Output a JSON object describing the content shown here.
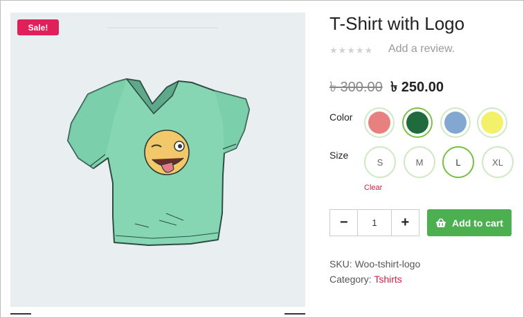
{
  "product": {
    "sale_badge": "Sale!",
    "title": "T-Shirt with Logo",
    "rating_stars": 5,
    "rating_value": 0,
    "review_link": "Add a review.",
    "price_old": "৳ 300.00",
    "price_new": "৳ 250.00"
  },
  "attributes": {
    "color_label": "Color",
    "size_label": "Size",
    "colors": [
      {
        "name": "red",
        "hex": "#e88080",
        "selected": false
      },
      {
        "name": "green",
        "hex": "#1f6b3d",
        "selected": true
      },
      {
        "name": "blue",
        "hex": "#82a8d2",
        "selected": false
      },
      {
        "name": "yellow",
        "hex": "#f3f06a",
        "selected": false
      }
    ],
    "sizes": [
      {
        "label": "S",
        "selected": false
      },
      {
        "label": "M",
        "selected": false
      },
      {
        "label": "L",
        "selected": true
      },
      {
        "label": "XL",
        "selected": false
      }
    ],
    "clear_label": "Clear"
  },
  "cart": {
    "minus": "−",
    "plus": "+",
    "quantity": "1",
    "add_label": "Add to cart",
    "icon": "basket-icon"
  },
  "meta": {
    "sku_label": "SKU: ",
    "sku_value": "Woo-tshirt-logo",
    "category_label": "Category: ",
    "category_value": "Tshirts"
  },
  "colors": {
    "sale": "#e0205a",
    "accent_green": "#4caf50",
    "swatch_border": "#cfe9c4",
    "swatch_selected": "#7ac143",
    "link": "#d0204a"
  }
}
